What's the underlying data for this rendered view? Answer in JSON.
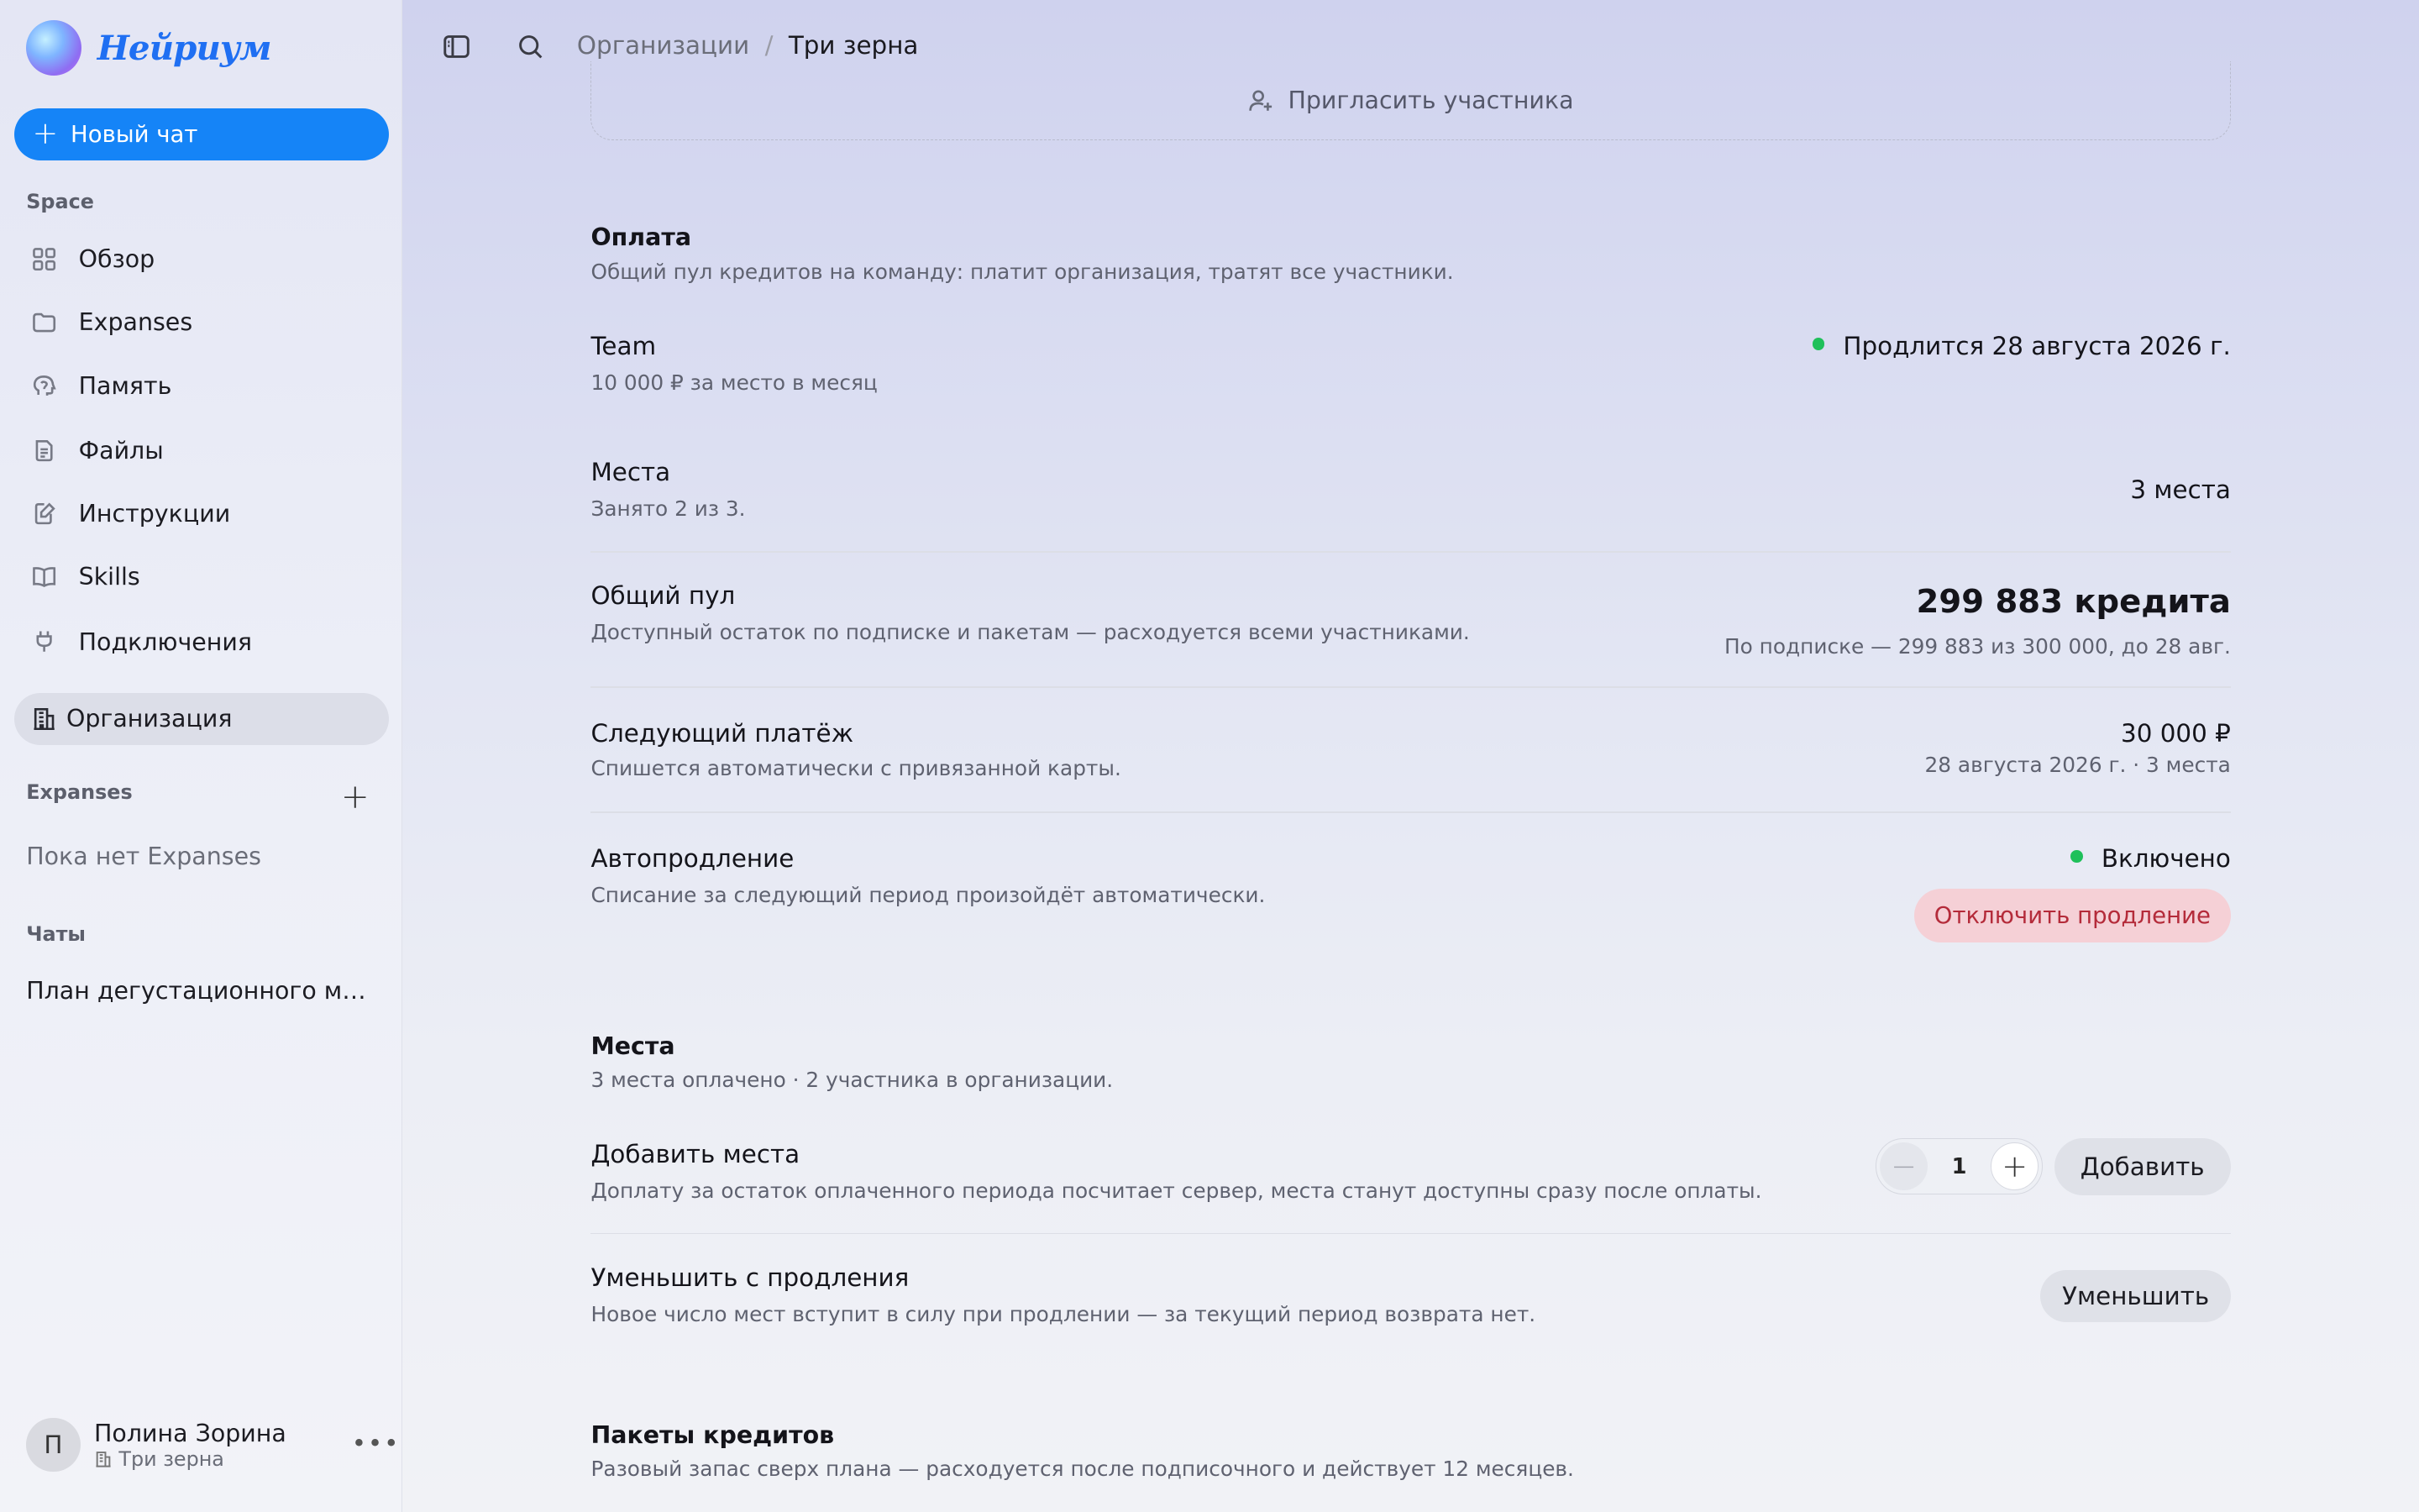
{
  "app": {
    "logo_text": "Нейриум"
  },
  "sidebar": {
    "new_chat": "Новый чат",
    "space_label": "Space",
    "items": [
      {
        "label": "Обзор",
        "icon": "grid-icon"
      },
      {
        "label": "Expanses",
        "icon": "folder-icon"
      },
      {
        "label": "Память",
        "icon": "brain-icon"
      },
      {
        "label": "Файлы",
        "icon": "file-icon"
      },
      {
        "label": "Инструкции",
        "icon": "edit-doc-icon"
      },
      {
        "label": "Skills",
        "icon": "book-icon"
      },
      {
        "label": "Подключения",
        "icon": "plug-icon"
      }
    ],
    "organization": "Организация",
    "expanses_label": "Expanses",
    "expanses_empty": "Пока нет Expanses",
    "chats_label": "Чаты",
    "chats": [
      "План дегустационного меню"
    ],
    "user": {
      "initial": "П",
      "name": "Полина Зорина",
      "org": "Три зерна"
    }
  },
  "breadcrumb": {
    "parent": "Организации",
    "sep": "/",
    "current": "Три зерна"
  },
  "invite_label": "Пригласить участника",
  "billing": {
    "title": "Оплата",
    "subtitle": "Общий пул кредитов на команду: платит организация, тратят все участники.",
    "plan": {
      "title": "Team",
      "sub": "10 000 ₽ за место в месяц",
      "status": "Продлится 28 августа 2026 г."
    },
    "seats": {
      "title": "Места",
      "sub": "Занято 2 из 3.",
      "value": "3 места"
    },
    "pool": {
      "title": "Общий пул",
      "sub": "Доступный остаток по подписке и пакетам — расходуется всеми участниками.",
      "value": "299 883 кредита",
      "detail": "По подписке — 299 883 из 300 000, до 28 авг."
    },
    "next_payment": {
      "title": "Следующий платёж",
      "sub": "Спишется автоматически с привязанной карты.",
      "value": "30 000 ₽",
      "detail": "28 августа 2026 г. · 3 места"
    },
    "autorenew": {
      "title": "Автопродление",
      "sub": "Списание за следующий период произойдёт автоматически.",
      "status": "Включено",
      "button": "Отключить продление"
    }
  },
  "seats_section": {
    "title": "Места",
    "subtitle": "3 места оплачено · 2 участника в организации.",
    "add": {
      "title": "Добавить места",
      "sub": "Доплату за остаток оплаченного периода посчитает сервер, места станут доступны сразу после оплаты.",
      "minus": "−",
      "qty": "1",
      "plus": "+",
      "button": "Добавить"
    },
    "reduce": {
      "title": "Уменьшить с продления",
      "sub": "Новое число мест вступит в силу при продлении — за текущий период возврата нет.",
      "button": "Уменьшить"
    }
  },
  "packages": {
    "title": "Пакеты кредитов",
    "subtitle": "Разовый запас сверх плана — расходуется после подписочного и действует 12 месяцев."
  },
  "colors": {
    "accent": "#1584f7",
    "status_ok": "#1fc05a",
    "danger_bg": "#f5d0d6",
    "danger_text": "#b42b3a"
  }
}
